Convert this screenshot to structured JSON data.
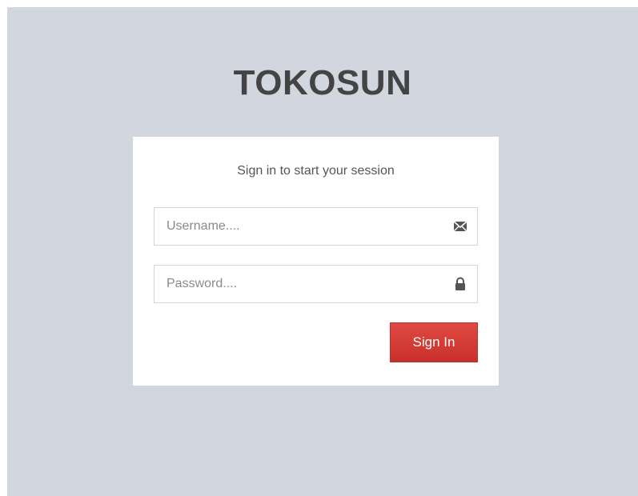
{
  "app": {
    "logo_text": "TOKOSUN"
  },
  "login": {
    "message": "Sign in to start your session",
    "username": {
      "value": "",
      "placeholder": "Username....",
      "icon": "envelope-icon"
    },
    "password": {
      "value": "",
      "placeholder": "Password....",
      "icon": "lock-icon"
    },
    "submit_label": "Sign In"
  },
  "colors": {
    "page_background": "#d2d6de",
    "box_background": "#ffffff",
    "button_background": "#dd4b39",
    "logo_text": "#444444"
  }
}
